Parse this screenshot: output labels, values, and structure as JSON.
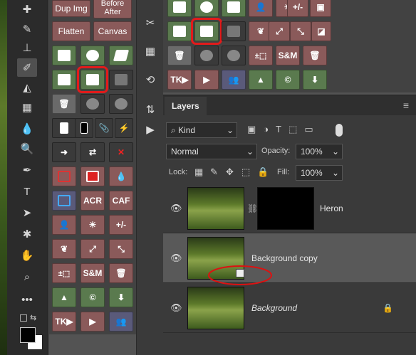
{
  "panelA": {
    "dup_img": "Dup Img",
    "before_after": "Before After",
    "flatten": "Flatten",
    "canvas": "Canvas",
    "acr": "ACR",
    "caf": "CAF",
    "plus_minus": "+/-",
    "sm": "S&M",
    "tk": "TK"
  },
  "panelC": {
    "plus_minus": "+/-",
    "sm": "S&M",
    "tk": "TK"
  },
  "layers": {
    "tab_label": "Layers",
    "filter_kind": "Kind",
    "blend_mode": "Normal",
    "opacity_label": "Opacity:",
    "opacity_value": "100%",
    "lock_label": "Lock:",
    "fill_label": "Fill:",
    "fill_value": "100%",
    "items": [
      {
        "name": "Heron"
      },
      {
        "name": "Background copy"
      },
      {
        "name": "Background"
      }
    ]
  }
}
